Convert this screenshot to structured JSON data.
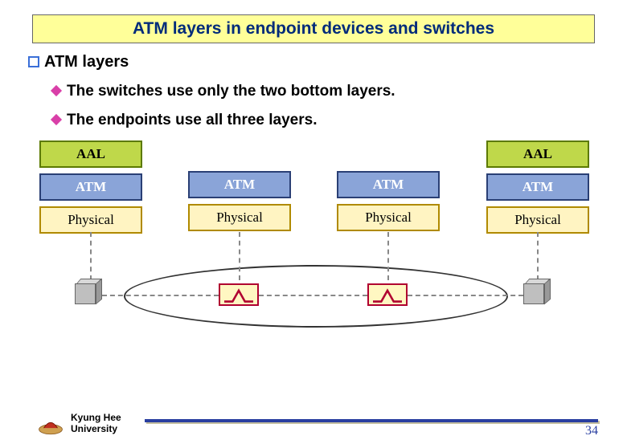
{
  "title": "ATM layers in endpoint devices and switches",
  "section": "ATM layers",
  "points": [
    "The switches use only the two bottom layers.",
    "The endpoints use all three layers."
  ],
  "layers": {
    "aal": "AAL",
    "atm": "ATM",
    "phys": "Physical"
  },
  "footer": {
    "line1": "Kyung Hee",
    "line2": "University"
  },
  "page": "34"
}
